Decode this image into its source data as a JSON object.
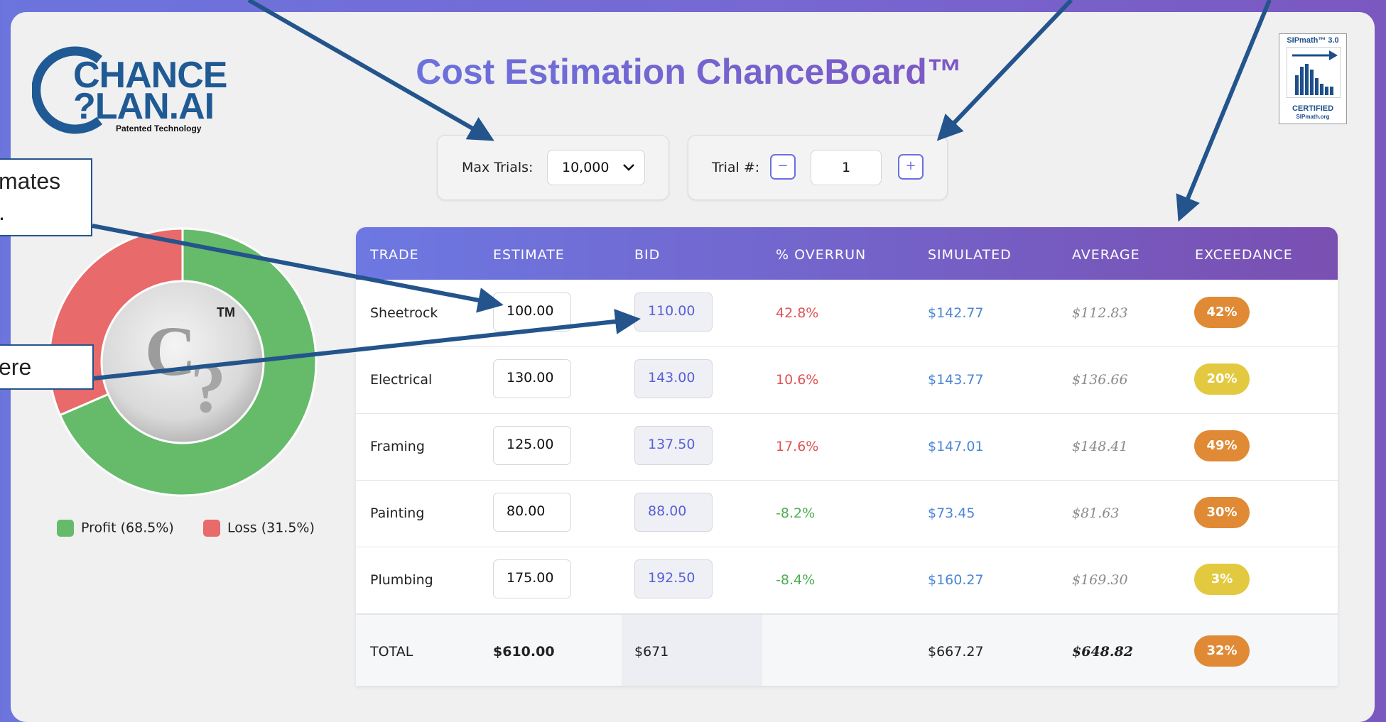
{
  "app": {
    "title": "Cost Estimation ChanceBoard™",
    "logo": {
      "line1": "CHANCE",
      "line2": "?LAN.AI",
      "tagline": "Patented Technology"
    },
    "badge": {
      "top": "SIPmath™ 3.0",
      "bottom": "CERTIFIED",
      "sub": "SIPmath.org"
    }
  },
  "controls": {
    "max_trials_label": "Max Trials:",
    "max_trials_value": "10,000",
    "trial_label": "Trial #:",
    "trial_value": "1",
    "minus_label": "−",
    "plus_label": "+"
  },
  "donut": {
    "profit_pct": 68.5,
    "loss_pct": 31.5,
    "profit_color": "#66bb6a",
    "loss_color": "#e86a6a",
    "center_mark": "TM",
    "legend": {
      "profit": "Profit (68.5%)",
      "loss": "Loss (31.5%)"
    }
  },
  "table": {
    "headers": {
      "trade": "TRADE",
      "estimate": "ESTIMATE",
      "bid": "BID",
      "overrun": "% OVERRUN",
      "simulated": "SIMULATED",
      "average": "AVERAGE",
      "exceedance": "EXCEEDANCE"
    },
    "rows": [
      {
        "trade": "Sheetrock",
        "estimate": "100.00",
        "bid": "110.00",
        "overrun": "42.8%",
        "overrun_color": "#e05252",
        "simulated": "$142.77",
        "average": "$112.83",
        "exceedance": "42%",
        "pill_color": "#e08a35"
      },
      {
        "trade": "Electrical",
        "estimate": "130.00",
        "bid": "143.00",
        "overrun": "10.6%",
        "overrun_color": "#e05252",
        "simulated": "$143.77",
        "average": "$136.66",
        "exceedance": "20%",
        "pill_color": "#e2c93f"
      },
      {
        "trade": "Framing",
        "estimate": "125.00",
        "bid": "137.50",
        "overrun": "17.6%",
        "overrun_color": "#e05252",
        "simulated": "$147.01",
        "average": "$148.41",
        "exceedance": "49%",
        "pill_color": "#e08a35"
      },
      {
        "trade": "Painting",
        "estimate": "80.00",
        "bid": "88.00",
        "overrun": "-8.2%",
        "overrun_color": "#4caf50",
        "simulated": "$73.45",
        "average": "$81.63",
        "exceedance": "30%",
        "pill_color": "#e08a35"
      },
      {
        "trade": "Plumbing",
        "estimate": "175.00",
        "bid": "192.50",
        "overrun": "-8.4%",
        "overrun_color": "#4caf50",
        "simulated": "$160.27",
        "average": "$169.30",
        "exceedance": "3%",
        "pill_color": "#e2c93f"
      }
    ],
    "total": {
      "label": "TOTAL",
      "estimate": "$610.00",
      "bid": "$671",
      "simulated": "$667.27",
      "average": "$648.82",
      "exceedance": "32%",
      "pill_color": "#e08a35"
    }
  },
  "callouts": {
    "upper": {
      "line1": "mates",
      "line2": "."
    },
    "lower": {
      "line1": "ere"
    }
  }
}
